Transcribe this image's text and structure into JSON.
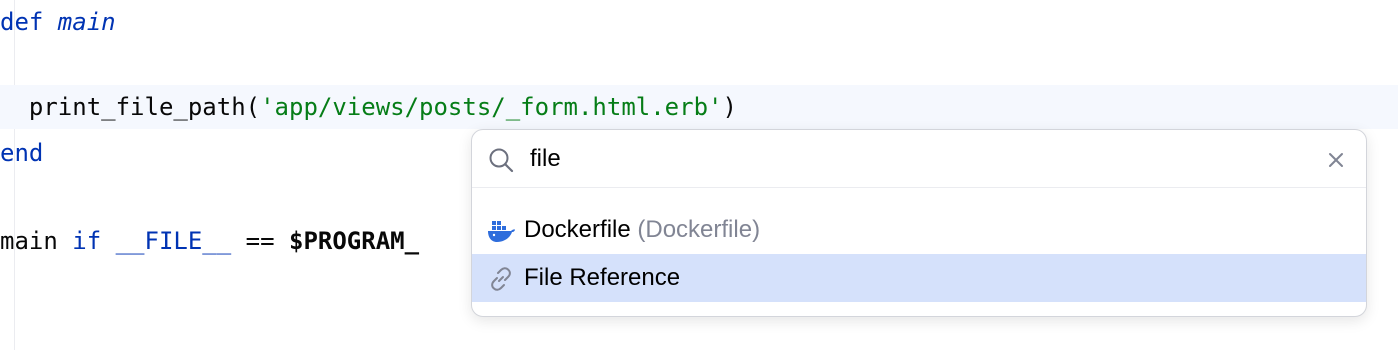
{
  "editor": {
    "lines": [
      {
        "tokens": [
          {
            "text": "def ",
            "kind": "kw"
          },
          {
            "text": "main",
            "kind": "fn-italic"
          }
        ]
      },
      {
        "tokens": []
      },
      {
        "current": true,
        "tokens": [
          {
            "text": "  print_file_path(",
            "kind": "plain"
          },
          {
            "text": "'app/views/posts/_form.html.erb'",
            "kind": "str"
          },
          {
            "text": ")",
            "kind": "plain"
          }
        ]
      },
      {
        "tokens": [
          {
            "text": "end",
            "kind": "kw"
          }
        ]
      },
      {
        "tokens": []
      },
      {
        "tokens": [
          {
            "text": "main ",
            "kind": "plain"
          },
          {
            "text": "if",
            "kind": "kw"
          },
          {
            "text": " ",
            "kind": "plain"
          },
          {
            "text": "__FILE__",
            "kind": "kw"
          },
          {
            "text": " == ",
            "kind": "plain"
          },
          {
            "text": "$PROGRAM_",
            "kind": "glob"
          }
        ]
      }
    ]
  },
  "popup": {
    "search": {
      "value": "file",
      "icon": "search-icon"
    },
    "close_icon": "close-icon",
    "items": [
      {
        "label": "Dockerfile",
        "hint": " (Dockerfile)",
        "icon": "docker-icon",
        "selected": false
      },
      {
        "label": "File Reference",
        "hint": "",
        "icon": "link-icon",
        "selected": true
      }
    ]
  },
  "colors": {
    "keyword": "#0033b3",
    "string": "#067d17",
    "selection": "#d5e1fb",
    "current_line": "#f5f8fe",
    "hint": "#818594",
    "docker_blue": "#2e6ddc"
  }
}
